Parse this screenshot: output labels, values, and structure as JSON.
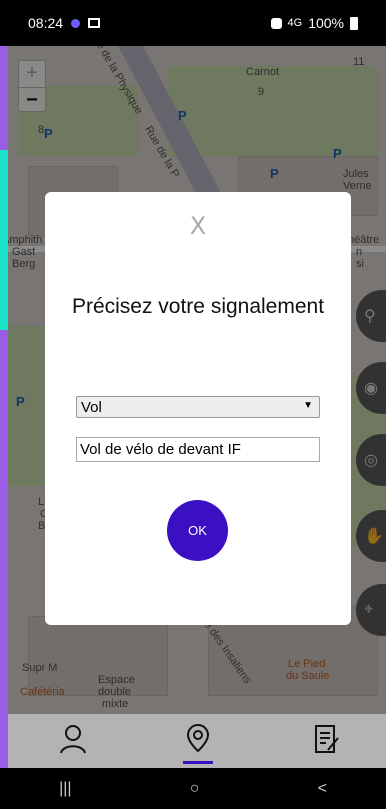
{
  "status_bar": {
    "time": "08:24",
    "signal": "4G",
    "battery": "100%"
  },
  "map": {
    "zoom_in": "+",
    "zoom_out": "−",
    "labels": {
      "physique": "Rue de la Physique",
      "carnot": "Carnot",
      "rue_p": "Rue de la P",
      "jules_verne_1": "Jules",
      "jules_verne_2": "Verne",
      "amphi_1": "Amphith",
      "amphi_2": "Gast",
      "amphi_3": "Berg",
      "theatre_1": "héâtre",
      "theatre_2": "n",
      "theatre_3": "si",
      "insallens": "ge des Insaliens",
      "supr": "Supr M",
      "cafeteria": "Cafétéria",
      "espace_1": "Espace",
      "espace_2": "double",
      "espace_3": "mixte",
      "pied_1": "Le Pied",
      "pied_2": "du Saule",
      "num_11": "11",
      "num_8": "8",
      "num_9": "9",
      "lag": "La",
      "g": "G",
      "be": "Be"
    },
    "parking": "P"
  },
  "modal": {
    "close_label": "X",
    "title": "Précisez votre signalement",
    "select_value": "Vol",
    "text_value": "Vol de vélo de devant IF",
    "ok_label": "OK"
  },
  "bottom_nav": {
    "items": [
      "profile-icon",
      "location-pin-icon",
      "report-edit-icon"
    ],
    "active": "location-pin-icon",
    "accent": "#3a10c2"
  },
  "android_nav": {
    "recents": "|||",
    "home": "○",
    "back": "<"
  }
}
